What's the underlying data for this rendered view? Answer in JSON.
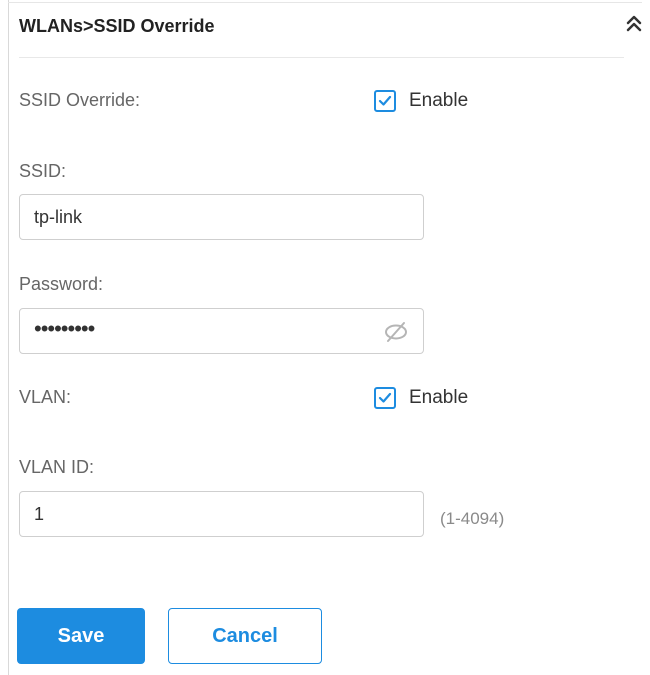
{
  "header": {
    "title": "WLANs>SSID Override",
    "collapse_icon": "double-chevron-up-icon"
  },
  "form": {
    "ssid_override": {
      "label": "SSID Override:",
      "checkbox_label": "Enable",
      "checked": true
    },
    "ssid": {
      "label": "SSID:",
      "value": "tp-link"
    },
    "password": {
      "label": "Password:",
      "value": "•••••••••",
      "toggle_icon": "eye-slash-icon"
    },
    "vlan": {
      "label": "VLAN:",
      "checkbox_label": "Enable",
      "checked": true
    },
    "vlan_id": {
      "label": "VLAN ID:",
      "value": "1",
      "range_hint": "(1-4094)"
    }
  },
  "actions": {
    "save_label": "Save",
    "cancel_label": "Cancel"
  },
  "colors": {
    "accent": "#1d8ce0",
    "text": "#333333",
    "label": "#666666",
    "hint": "#8a8a8a",
    "border": "#cfcfcf"
  }
}
